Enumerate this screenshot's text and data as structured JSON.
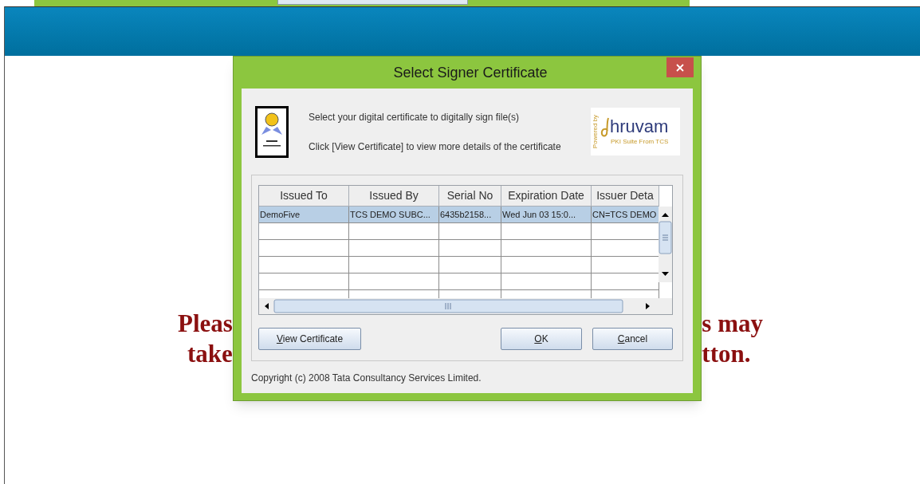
{
  "page": {
    "message_left": [
      "Pleas",
      "take"
    ],
    "message_right": [
      "s may",
      "tton."
    ]
  },
  "dialog": {
    "title": "Select Signer Certificate",
    "instructions": [
      "Select your digital certificate to digitally sign file(s)",
      "Click [View Certificate] to view more details of the certificate"
    ],
    "logo": {
      "tagline_top": "Powered by",
      "name": "hruvam",
      "tagline_bottom": "PKI Suite From TCS"
    },
    "table": {
      "columns": [
        "Issued To",
        "Issued By",
        "Serial No",
        "Expiration Date",
        "Issuer Deta"
      ],
      "rows": [
        {
          "selected": true,
          "cells": [
            "DemoFive",
            "TCS DEMO SUBC...",
            "6435b2158...",
            "Wed Jun 03 15:0...",
            "CN=TCS DEMO"
          ]
        }
      ]
    },
    "buttons": {
      "view": "View Certificate",
      "ok": "OK",
      "cancel": "Cancel"
    },
    "copyright": "Copyright (c) 2008 Tata Consultancy Services Limited."
  }
}
